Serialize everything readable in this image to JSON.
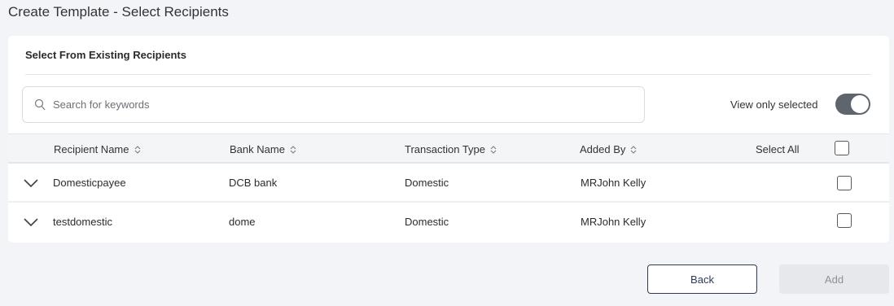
{
  "page": {
    "title": "Create Template - Select Recipients"
  },
  "card": {
    "title": "Select From Existing Recipients"
  },
  "search": {
    "placeholder": "Search for keywords",
    "value": ""
  },
  "filter": {
    "label": "View only selected",
    "toggle_on": true
  },
  "table": {
    "columns": [
      "Recipient Name",
      "Bank Name",
      "Transaction Type",
      "Added By"
    ],
    "select_all_label": "Select All",
    "rows": [
      {
        "recipient_name": "Domesticpayee",
        "bank_name": "DCB bank",
        "transaction_type": "Domestic",
        "added_by": "MRJohn Kelly",
        "selected": false
      },
      {
        "recipient_name": "testdomestic",
        "bank_name": "dome",
        "transaction_type": "Domestic",
        "added_by": "MRJohn Kelly",
        "selected": false
      }
    ]
  },
  "actions": {
    "back_label": "Back",
    "add_label": "Add",
    "add_disabled": true
  },
  "icons": {
    "search": "search-icon",
    "sort": "sort-icon",
    "expand": "chevron-down-icon"
  },
  "colors": {
    "toggle_track": "#5f656c",
    "back_border": "#2d3a55",
    "add_disabled_bg": "#e6e8eb"
  }
}
